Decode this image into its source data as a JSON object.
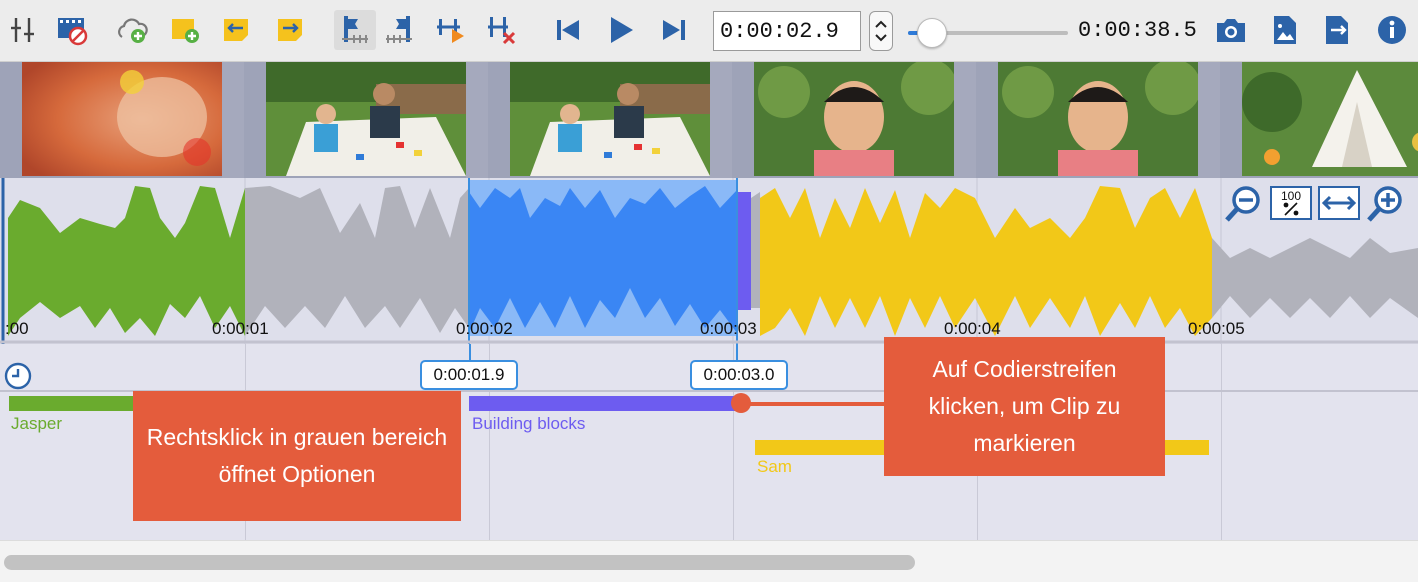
{
  "toolbar": {
    "icons": [
      "sliders-icon",
      "film-edit-icon",
      "cloud-add-icon",
      "note-add-icon",
      "note-back-icon",
      "note-forward-icon",
      "set-start-icon",
      "set-end-icon",
      "play-selection-icon",
      "delete-marker-icon",
      "skip-back-icon",
      "play-icon",
      "skip-forward-icon",
      "camera-icon",
      "image-export-icon",
      "document-export-icon",
      "info-icon"
    ],
    "current_time": "0:00:02.9",
    "duration": "0:00:38.5",
    "position_fraction": 0.075
  },
  "waveform": {
    "ruler_labels": [
      ":00",
      "0:00:01",
      "0:00:02",
      "0:00:03",
      "0:00:04",
      "0:00:05"
    ],
    "zoom_icons": [
      "zoom-out-icon",
      "zoom-100-icon",
      "fit-width-icon",
      "zoom-in-icon"
    ],
    "zoom_100_text": "100",
    "colors": {
      "green": "#6aab2e",
      "gray": "#b1b2bb",
      "blue": "#3a86f4",
      "blue_light": "#8ab9f7",
      "yellow": "#f2c818",
      "marker": "#6d5cf0"
    }
  },
  "selection": {
    "start": "0:00:01.9",
    "end": "0:00:03.0"
  },
  "codes": [
    {
      "label": "Jasper",
      "color": "#6aab2e"
    },
    {
      "label": "Building blocks",
      "color": "#6d5cf0"
    },
    {
      "label": "Sam",
      "color": "#f2c818"
    }
  ],
  "callouts": {
    "left": "Rechtsklick in grauen bereich öffnet Optionen",
    "right": "Auf Codierstreifen klicken, um Clip zu markieren"
  }
}
